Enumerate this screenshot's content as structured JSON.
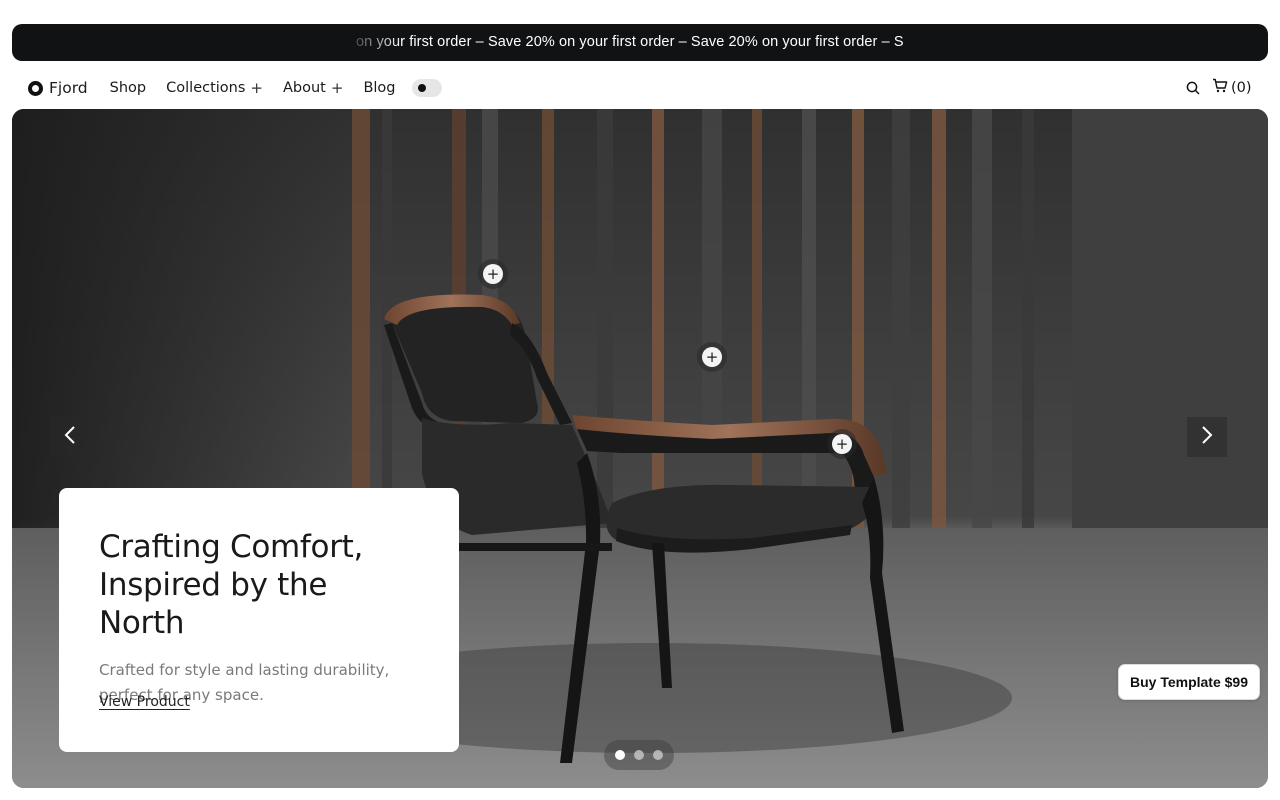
{
  "announcement": {
    "text": "on your first order  –  Save 20% on your first order  –  Save 20% on your first order  –  S"
  },
  "nav": {
    "brand": "Fjord",
    "items": [
      {
        "label": "Shop"
      },
      {
        "label": "Collections",
        "expand": "+"
      },
      {
        "label": "About",
        "expand": "+"
      },
      {
        "label": "Blog"
      }
    ],
    "theme_toggle": "dark-mode-toggle",
    "cart_count": "(0)"
  },
  "icons": {
    "search": "search-icon",
    "cart": "cart-icon",
    "prev": "chevron-left-icon",
    "next": "chevron-right-icon",
    "hotspot": "plus-icon"
  },
  "hero": {
    "title_line1": "Crafting Comfort,",
    "title_line2": "Inspired by the North",
    "desc_line1": "Crafted for style and lasting durability,",
    "desc_line2": "perfect for any space.",
    "cta": "View Product",
    "hotspot_symbol": "+",
    "slides_total": 3,
    "active_slide": 1
  },
  "buy_button": "Buy Template $99",
  "colors": {
    "announcement_bg": "#111214",
    "hero_bg": "#414141",
    "accent_wood": "#8a5a3c"
  }
}
